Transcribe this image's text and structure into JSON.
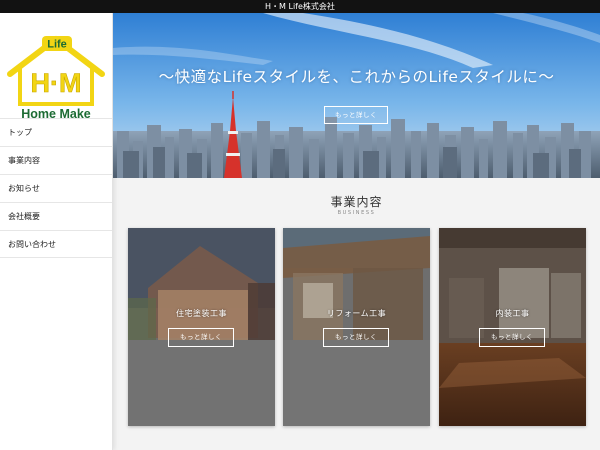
{
  "site": {
    "title": "H・M Life株式会社"
  },
  "logo": {
    "badge": "Life",
    "monogram": "H·M",
    "wordmark": "Home Make",
    "color_main": "#f2d514",
    "color_text": "#1c6b33"
  },
  "nav": {
    "items": [
      {
        "label": "トップ"
      },
      {
        "label": "事業内容"
      },
      {
        "label": "お知らせ"
      },
      {
        "label": "会社概要"
      },
      {
        "label": "お問い合わせ"
      }
    ]
  },
  "hero": {
    "headline": "〜快適なLifeスタイルを、これからのLifeスタイルに〜",
    "button": "もっと詳しく"
  },
  "business": {
    "title": "事業内容",
    "subtitle": "BUSINESS",
    "cards": [
      {
        "label": "住宅塗装工事",
        "button": "もっと詳しく"
      },
      {
        "label": "リフォーム工事",
        "button": "もっと詳しく"
      },
      {
        "label": "内装工事",
        "button": "もっと詳しく"
      }
    ]
  },
  "colors": {
    "topbar": "#121212",
    "background": "#f3f3f3",
    "tower": "#d6322b"
  }
}
